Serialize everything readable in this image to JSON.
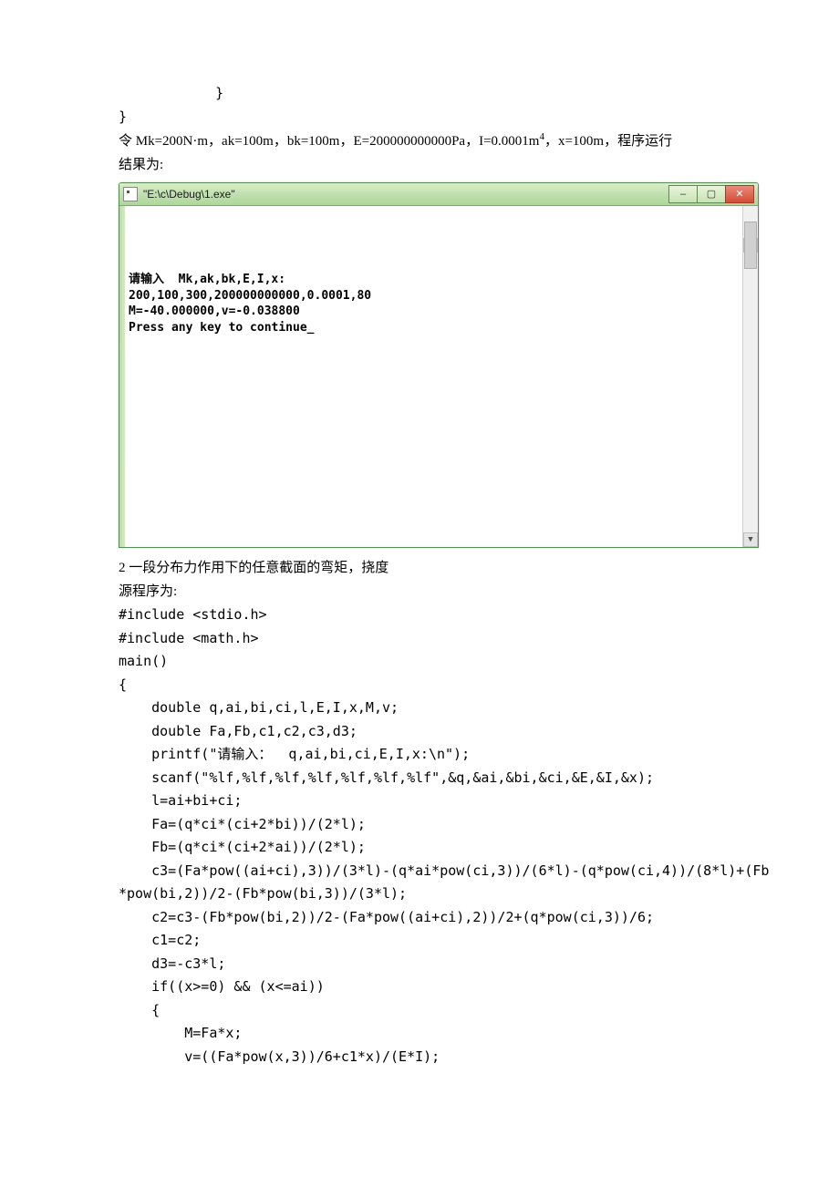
{
  "top_code": {
    "brace1": "    }",
    "brace2": "}"
  },
  "param_line": {
    "prefix": "令 Mk=200N·m，ak=100m，bk=100m，E=200000000000Pa，I=0.0001m",
    "sup": "4",
    "suffix": "，x=100m，程序运行"
  },
  "result_label": "结果为:",
  "console": {
    "title": "\"E:\\c\\Debug\\1.exe\"",
    "lines": [
      "请输入  Mk,ak,bk,E,I,x:",
      "200,100,300,200000000000,0.0001,80",
      "M=-40.000000,v=-0.038800",
      "Press any key to continue_"
    ],
    "buttons": {
      "min": "–",
      "max": "▢",
      "close": "✕"
    }
  },
  "section2": {
    "heading": "2 一段分布力作用下的任意截面的弯矩，挠度",
    "source_label": "源程序为:",
    "code": [
      "#include <stdio.h>",
      "#include <math.h>",
      "main()",
      "{",
      "    double q,ai,bi,ci,l,E,I,x,M,v;",
      "    double Fa,Fb,c1,c2,c3,d3;",
      "    printf(\"请输入：  q,ai,bi,ci,E,I,x:\\n\");",
      "    scanf(\"%lf,%lf,%lf,%lf,%lf,%lf,%lf\",&q,&ai,&bi,&ci,&E,&I,&x);",
      "    l=ai+bi+ci;",
      "    Fa=(q*ci*(ci+2*bi))/(2*l);",
      "    Fb=(q*ci*(ci+2*ai))/(2*l);",
      "    c3=(Fa*pow((ai+ci),3))/(3*l)-(q*ai*pow(ci,3))/(6*l)-(q*pow(ci,4))/(8*l)+(Fb",
      "*pow(bi,2))/2-(Fb*pow(bi,3))/(3*l);",
      "    c2=c3-(Fb*pow(bi,2))/2-(Fa*pow((ai+ci),2))/2+(q*pow(ci,3))/6;",
      "    c1=c2;",
      "    d3=-c3*l;",
      "    if((x>=0) && (x<=ai))",
      "    {",
      "        M=Fa*x;",
      "        v=((Fa*pow(x,3))/6+c1*x)/(E*I);"
    ]
  }
}
